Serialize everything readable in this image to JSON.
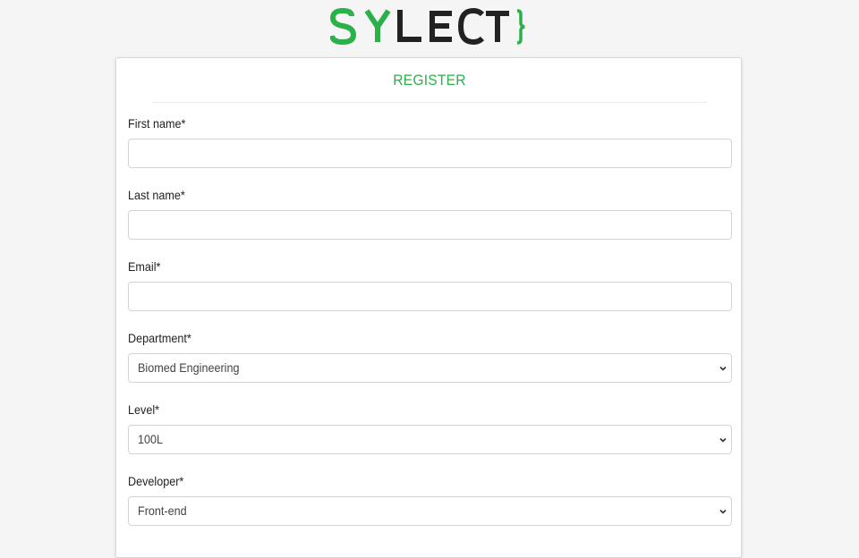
{
  "brand": {
    "logo_text": "SYLECT}",
    "green": "#2bb04a",
    "dark": "#222222"
  },
  "form": {
    "title": "REGISTER",
    "fields": [
      {
        "label": "First name*",
        "type": "text",
        "value": ""
      },
      {
        "label": "Last name*",
        "type": "text",
        "value": ""
      },
      {
        "label": "Email*",
        "type": "text",
        "value": ""
      },
      {
        "label": "Department*",
        "type": "select",
        "selected": "Biomed Engineering"
      },
      {
        "label": "Level*",
        "type": "select",
        "selected": "100L"
      },
      {
        "label": "Developer*",
        "type": "select",
        "selected": "Front-end"
      }
    ]
  },
  "icons": {
    "select_indicator": "chevron-down-icon"
  }
}
